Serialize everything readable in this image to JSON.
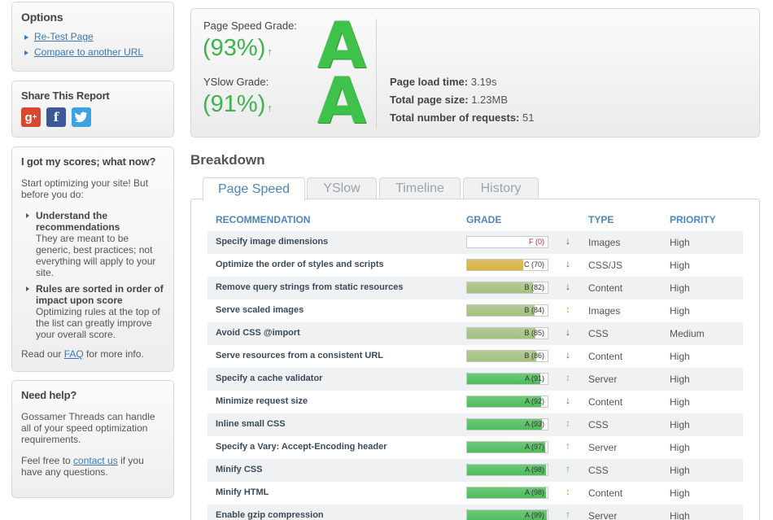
{
  "options": {
    "title": "Options",
    "links": [
      "Re-Test Page",
      "Compare to another URL"
    ]
  },
  "share": {
    "title": "Share This Report",
    "icons": [
      "google-plus-icon",
      "facebook-icon",
      "twitter-icon"
    ],
    "colors": {
      "google": "#d6492f",
      "facebook": "#3b5998",
      "twitter": "#3aa3e0"
    }
  },
  "what_now": {
    "title": "I got my scores; what now?",
    "intro": "Start optimizing your site! But before you do:",
    "tips": [
      {
        "title": "Understand the recommendations",
        "body": "They are meant to be generic, best practices; not everything will apply to your site."
      },
      {
        "title": "Rules are sorted in order of impact upon score",
        "body": "Optimizing rules at the top of the list can greatly improve your overall score."
      }
    ],
    "faq_prefix": "Read our ",
    "faq_link": "FAQ",
    "faq_suffix": " for more info."
  },
  "help": {
    "title": "Need help?",
    "body": "Gossamer Threads can handle all of your speed optimization requirements.",
    "contact_prefix": "Feel free to ",
    "contact_link": "contact us",
    "contact_suffix": " if you have any questions."
  },
  "summary": {
    "pagespeed_label": "Page Speed Grade:",
    "pagespeed_pct": "(93%)",
    "pagespeed_letter": "A",
    "yslow_label": "YSlow Grade:",
    "yslow_pct": "(91%)",
    "yslow_letter": "A",
    "up_arrow": "↑",
    "stats": [
      {
        "label": "Page load time:",
        "value": "3.19s"
      },
      {
        "label": "Total page size:",
        "value": "1.23MB"
      },
      {
        "label": "Total number of requests:",
        "value": "51"
      }
    ],
    "accent": "#3fb34f"
  },
  "breakdown": {
    "title": "Breakdown",
    "tabs": [
      "Page Speed",
      "YSlow",
      "Timeline",
      "History"
    ],
    "columns": [
      "RECOMMENDATION",
      "GRADE",
      "TYPE",
      "PRIORITY"
    ],
    "rows": [
      {
        "rec": "Specify image dimensions",
        "grade": "F (0)",
        "pct": 0,
        "trend": "down",
        "type": "Images",
        "priority": "High"
      },
      {
        "rec": "Optimize the order of styles and scripts",
        "grade": "C (70)",
        "pct": 70,
        "trend": "down",
        "type": "CSS/JS",
        "priority": "High"
      },
      {
        "rec": "Remove query strings from static resources",
        "grade": "B (82)",
        "pct": 82,
        "trend": "down",
        "type": "Content",
        "priority": "High"
      },
      {
        "rec": "Serve scaled images",
        "grade": "B (84)",
        "pct": 84,
        "trend": "both",
        "type": "Images",
        "priority": "High"
      },
      {
        "rec": "Avoid CSS @import",
        "grade": "B (85)",
        "pct": 85,
        "trend": "down",
        "type": "CSS",
        "priority": "Medium"
      },
      {
        "rec": "Serve resources from a consistent URL",
        "grade": "B (86)",
        "pct": 86,
        "trend": "down",
        "type": "Content",
        "priority": "High"
      },
      {
        "rec": "Specify a cache validator",
        "grade": "A (91)",
        "pct": 91,
        "trend": "both",
        "type": "Server",
        "priority": "High"
      },
      {
        "rec": "Minimize request size",
        "grade": "A (92)",
        "pct": 92,
        "trend": "down",
        "type": "Content",
        "priority": "High"
      },
      {
        "rec": "Inline small CSS",
        "grade": "A (93)",
        "pct": 93,
        "trend": "both",
        "type": "CSS",
        "priority": "High"
      },
      {
        "rec": "Specify a Vary: Accept-Encoding header",
        "grade": "A (97)",
        "pct": 97,
        "trend": "up",
        "type": "Server",
        "priority": "High"
      },
      {
        "rec": "Minify CSS",
        "grade": "A (98)",
        "pct": 98,
        "trend": "up",
        "type": "CSS",
        "priority": "High"
      },
      {
        "rec": "Minify HTML",
        "grade": "A (98)",
        "pct": 98,
        "trend": "both",
        "type": "Content",
        "priority": "High"
      },
      {
        "rec": "Enable gzip compression",
        "grade": "A (99)",
        "pct": 99,
        "trend": "up",
        "type": "Server",
        "priority": "High"
      }
    ],
    "colors": {
      "A": "#4cbb5a",
      "B": "#a2c07e",
      "C": "#d6b23c",
      "F": "#cc2222",
      "down": "#cc2222",
      "up": "#3fb34f",
      "both": "#d4a02a"
    }
  }
}
